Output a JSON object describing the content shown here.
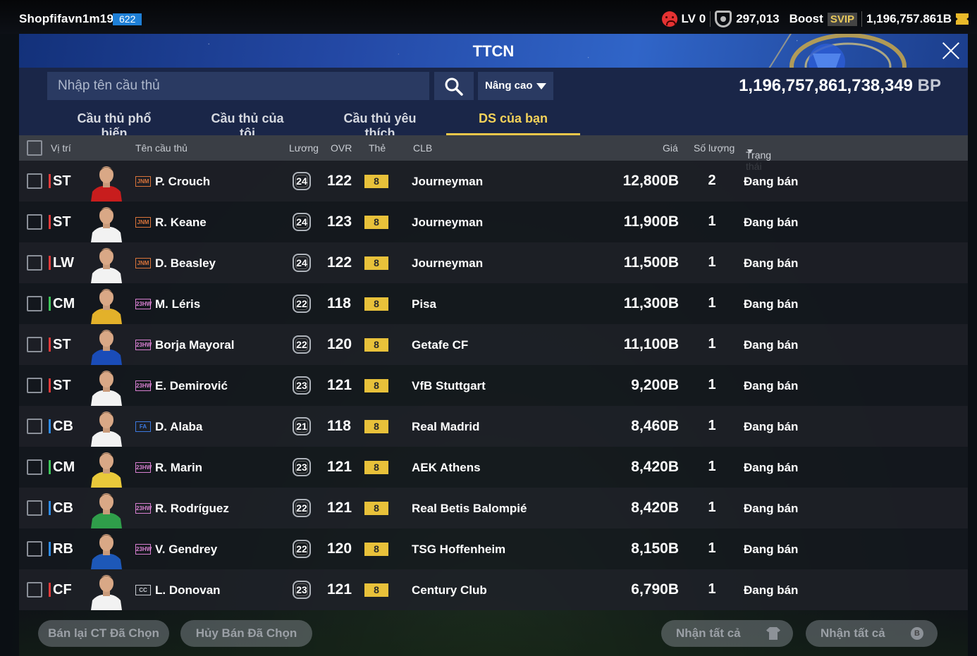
{
  "user": {
    "name": "Shopfifavn1m191",
    "level": "622"
  },
  "top": {
    "lv": "LV 0",
    "bp": "297,013",
    "boost": "Boost",
    "svip": "SVIP",
    "coins": "1,196,757.861B"
  },
  "window": {
    "title": "TTCN"
  },
  "search": {
    "placeholder": "Nhập tên cầu thủ",
    "advanced": "Nâng cao",
    "balance": "1,196,757,861,738,349",
    "balance_unit": "BP"
  },
  "tabs": [
    {
      "label": "Cầu thủ phổ biến"
    },
    {
      "label": "Cầu thủ của tôi"
    },
    {
      "label": "Cầu thủ yêu thích"
    },
    {
      "label": "DS của bạn",
      "active": true
    }
  ],
  "columns": {
    "position": "Vị trí",
    "name": "Tên cầu thủ",
    "wage": "Lương",
    "ovr": "OVR",
    "card": "Thẻ",
    "club": "CLB",
    "price": "Giá",
    "qty": "Số lượng",
    "status": "Trạng thái"
  },
  "rows": [
    {
      "pos": "ST",
      "pos_color": "#e03a3a",
      "badge": "JNM",
      "badge_color": "#d8733a",
      "name": "P. Crouch",
      "wage": "24",
      "ovr": "122",
      "card": "8",
      "club": "Journeyman",
      "price": "12,800B",
      "qty": "2",
      "status": "Đang bán",
      "kit": "#c81d1d"
    },
    {
      "pos": "ST",
      "pos_color": "#e03a3a",
      "badge": "JNM",
      "badge_color": "#d8733a",
      "name": "R. Keane",
      "wage": "24",
      "ovr": "123",
      "card": "8",
      "club": "Journeyman",
      "price": "11,900B",
      "qty": "1",
      "status": "Đang bán",
      "kit": "#f2f2f2"
    },
    {
      "pos": "LW",
      "pos_color": "#e03a3a",
      "badge": "JNM",
      "badge_color": "#d8733a",
      "name": "D. Beasley",
      "wage": "24",
      "ovr": "122",
      "card": "8",
      "club": "Journeyman",
      "price": "11,500B",
      "qty": "1",
      "status": "Đang bán",
      "kit": "#f2f2f2"
    },
    {
      "pos": "CM",
      "pos_color": "#3ec35a",
      "badge": "23HW",
      "badge_color": "#d77fd0",
      "name": "M. Léris",
      "wage": "22",
      "ovr": "118",
      "card": "8",
      "club": "Pisa",
      "price": "11,300B",
      "qty": "1",
      "status": "Đang bán",
      "kit": "#e3b12a"
    },
    {
      "pos": "ST",
      "pos_color": "#e03a3a",
      "badge": "23HW",
      "badge_color": "#d77fd0",
      "name": "Borja Mayoral",
      "wage": "22",
      "ovr": "120",
      "card": "8",
      "club": "Getafe CF",
      "price": "11,100B",
      "qty": "1",
      "status": "Đang bán",
      "kit": "#1a4cb8"
    },
    {
      "pos": "ST",
      "pos_color": "#e03a3a",
      "badge": "23HW",
      "badge_color": "#d77fd0",
      "name": "E. Demirović",
      "wage": "23",
      "ovr": "121",
      "card": "8",
      "club": "VfB Stuttgart",
      "price": "9,200B",
      "qty": "1",
      "status": "Đang bán",
      "kit": "#f2f2f2"
    },
    {
      "pos": "CB",
      "pos_color": "#2f8be6",
      "badge": "FA",
      "badge_color": "#3c79e0",
      "name": "D. Alaba",
      "wage": "21",
      "ovr": "118",
      "card": "8",
      "club": "Real Madrid",
      "price": "8,460B",
      "qty": "1",
      "status": "Đang bán",
      "kit": "#f2f2f2"
    },
    {
      "pos": "CM",
      "pos_color": "#3ec35a",
      "badge": "23HW",
      "badge_color": "#d77fd0",
      "name": "R. Marin",
      "wage": "23",
      "ovr": "121",
      "card": "8",
      "club": "AEK Athens",
      "price": "8,420B",
      "qty": "1",
      "status": "Đang bán",
      "kit": "#e9c93a"
    },
    {
      "pos": "CB",
      "pos_color": "#2f8be6",
      "badge": "23HW",
      "badge_color": "#d77fd0",
      "name": "R. Rodríguez",
      "wage": "22",
      "ovr": "121",
      "card": "8",
      "club": "Real Betis Balompié",
      "price": "8,420B",
      "qty": "1",
      "status": "Đang bán",
      "kit": "#2f9e4a"
    },
    {
      "pos": "RB",
      "pos_color": "#2f8be6",
      "badge": "23HW",
      "badge_color": "#d77fd0",
      "name": "V. Gendrey",
      "wage": "22",
      "ovr": "120",
      "card": "8",
      "club": "TSG Hoffenheim",
      "price": "8,150B",
      "qty": "1",
      "status": "Đang bán",
      "kit": "#1d58b8"
    },
    {
      "pos": "CF",
      "pos_color": "#e03a3a",
      "badge": "CC",
      "badge_color": "#c8ccd2",
      "name": "L. Donovan",
      "wage": "23",
      "ovr": "121",
      "card": "8",
      "club": "Century Club",
      "price": "6,790B",
      "qty": "1",
      "status": "Đang bán",
      "kit": "#f2f2f2"
    }
  ],
  "buttons": {
    "resell": "Bán lại CT Đã Chọn",
    "cancel": "Hủy Bán Đã Chọn",
    "claim_all_1": "Nhận tất cả",
    "claim_all_2": "Nhận tất cả",
    "coin_symbol": "B"
  },
  "colors": {
    "accent_tab": "#e9c74a",
    "card_level": "#e8c13a",
    "title_blue": "#2449a6"
  }
}
